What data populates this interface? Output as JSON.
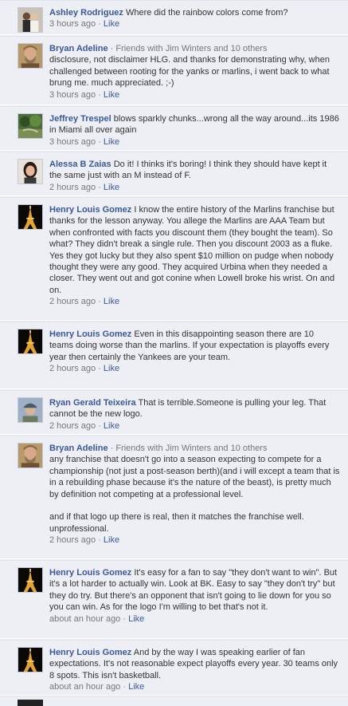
{
  "separator": " · ",
  "like_label": "Like",
  "comments": [
    {
      "author": "Ashley Rodriguez",
      "friends": "",
      "text": "Where did the rainbow colors come from?",
      "time": "3 hours ago",
      "avatar": "couple-photo"
    },
    {
      "author": "Bryan Adeline",
      "friends": "Friends with Jim Winters and 10 others",
      "text": "disclosure, not disclaimer HLG. and thanks for demonstrating why, when challenged between rooting for the yanks or marlins, i went back to what brung me. much appreciated. ;-)",
      "time": "3 hours ago",
      "avatar": "bearded-man"
    },
    {
      "author": "Jeffrey Trespel",
      "friends": "",
      "text": "blows sparkly chunks...wrong all the way around...its 1986 in Miami all over again",
      "time": "3 hours ago",
      "avatar": "garden-photo"
    },
    {
      "author": "Alessa B Zaias",
      "friends": "",
      "text": "Do it! I thinks it's boring! I think they should have kept it the same just with an M instead of F.",
      "time": "2 hours ago",
      "avatar": "woman-portrait"
    },
    {
      "author": "Henry Louis Gomez",
      "friends": "",
      "text": "I know the entire history of the Marlins franchise but thanks for the lesson anyway. You allege the Marlins are AAA Team but when confronted with facts you discount them (they bought the team). So what? They didn't break a single rule. Then you discount 2003 as a fluke. Yes they got lucky but they also spent $10 million on pudge when nobody thought they were any good. They acquired Urbina when they needed a closer. They went out and got conine when Lowell broke his wrist. On and on.",
      "time": "2 hours ago",
      "avatar": "eiffel-tower-night"
    },
    {
      "author": "Henry Louis Gomez",
      "friends": "",
      "text": "Even in this disappointing season there are 10 teams doing worse than the marlins. If your expectation is playoffs every year then certainly the Yankees are your team.",
      "time": "2 hours ago",
      "avatar": "eiffel-tower-night"
    },
    {
      "author": "Ryan Gerald Teixeira",
      "friends": "",
      "text": "That is terrible.Someone is pulling your leg. That cannot be the new logo.",
      "time": "2 hours ago",
      "avatar": "man-with-cap"
    },
    {
      "author": "Bryan Adeline",
      "friends": "Friends with Jim Winters and 10 others",
      "text": "any franchise that doesn't go into a season expecting to compete for a championship (not just a post-season berth)(and i will except a team that is in a rebuilding phase because it's the nature of the beast), is pretty much by definition not competing at a professional level.\n\nand if that logo up there is real, then it matches the franchise well. unprofessional.",
      "time": "2 hours ago",
      "avatar": "bearded-man"
    },
    {
      "author": "Henry Louis Gomez",
      "friends": "",
      "text": "It's easy for a fan to say \"they don't want to win\". But it's a lot harder to actually win. Look at BK. Easy to say \"they don't try\" but they do try. But there's an opponent that isn't going to lie down for you so you can win. As for the logo I'm willing to bet that's not it.",
      "time": "about an hour ago",
      "avatar": "eiffel-tower-night"
    },
    {
      "author": "Henry Louis Gomez",
      "friends": "",
      "text": "And by the way I was speaking earlier of fan expectations. It's not reasonable expect playoffs every year. 30 teams only 8 spots. This isn't basketball.",
      "time": "about an hour ago",
      "avatar": "eiffel-tower-night"
    }
  ]
}
